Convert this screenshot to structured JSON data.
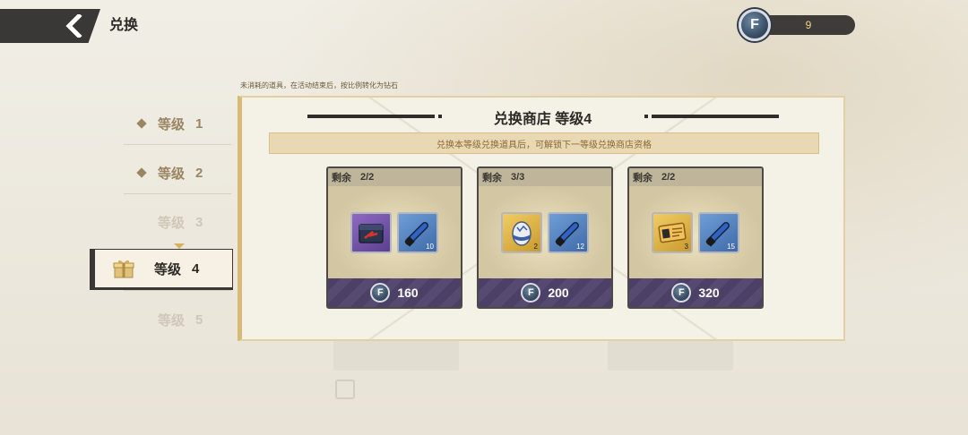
{
  "header": {
    "title": "兑换",
    "back_icon": "back-chevron-icon"
  },
  "currency": {
    "icon": "exchange-coin-icon",
    "coin_glyph": "F",
    "amount": "9"
  },
  "notice": "未消耗的道具，在活动结束后，按比例转化为钻石",
  "levels": [
    {
      "label": "等级",
      "num": "1",
      "state": "unlocked"
    },
    {
      "label": "等级",
      "num": "2",
      "state": "unlocked"
    },
    {
      "label": "等级",
      "num": "3",
      "state": "locked"
    },
    {
      "label": "等级",
      "num": "4",
      "state": "selected"
    },
    {
      "label": "等级",
      "num": "5",
      "state": "locked"
    }
  ],
  "shop": {
    "title": "兑换商店 等级4",
    "hint": "兑换本等级兑换道具后，可解锁下一等级兑换商店资格"
  },
  "offers": [
    {
      "remaining_label": "剩余",
      "remaining": "2/2",
      "items": [
        {
          "icon": "supply-box-icon",
          "slot_color": "purple",
          "qty": ""
        },
        {
          "icon": "blue-fuel-tube-icon",
          "slot_color": "blue",
          "qty": "10"
        }
      ],
      "price": "160"
    },
    {
      "remaining_label": "剩余",
      "remaining": "3/3",
      "items": [
        {
          "icon": "egg-capsule-icon",
          "slot_color": "gold",
          "qty": "2"
        },
        {
          "icon": "blue-fuel-tube-icon",
          "slot_color": "blue",
          "qty": "12"
        }
      ],
      "price": "200"
    },
    {
      "remaining_label": "剩余",
      "remaining": "2/2",
      "items": [
        {
          "icon": "gold-ticket-card-icon",
          "slot_color": "gold",
          "qty": "3"
        },
        {
          "icon": "blue-fuel-tube-icon",
          "slot_color": "blue",
          "qty": "15"
        }
      ],
      "price": "320"
    }
  ],
  "colors": {
    "accent_gold": "#d9b978",
    "dark": "#3a3836",
    "price_bar": "#4c4066",
    "coin_blue": "#3b4f66"
  }
}
